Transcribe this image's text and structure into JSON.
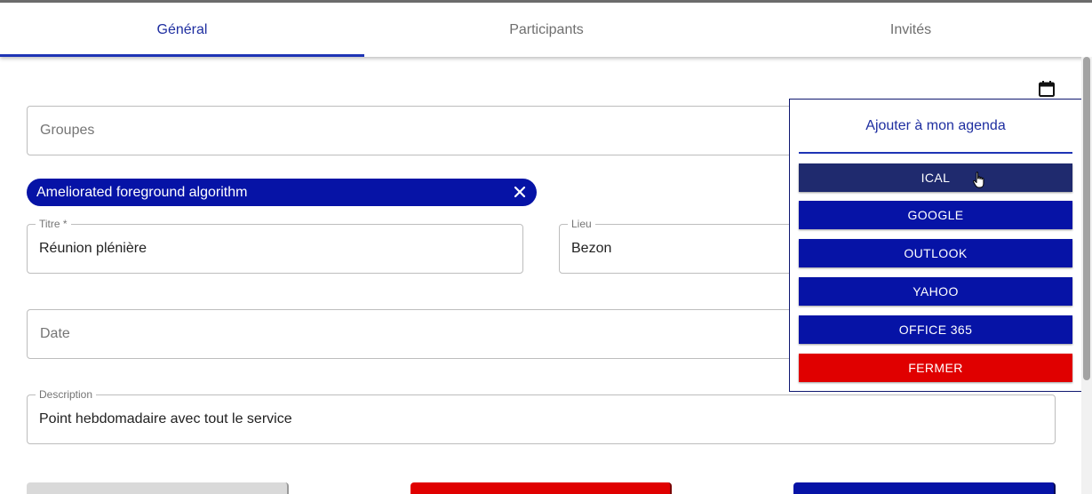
{
  "tabs": [
    {
      "label": "Général",
      "active": true
    },
    {
      "label": "Participants",
      "active": false
    },
    {
      "label": "Invités",
      "active": false
    }
  ],
  "form": {
    "groupes_placeholder": "Groupes",
    "chip_label": "Ameliorated foreground algorithm",
    "titre_label": "Titre *",
    "titre_value": "Réunion plénière",
    "lieu_label": "Lieu",
    "lieu_value": "Bezon",
    "date_placeholder": "Date",
    "description_label": "Description",
    "description_value": "Point hebdomadaire avec tout le service"
  },
  "agenda_popup": {
    "title": "Ajouter à mon agenda",
    "buttons": [
      "ICAL",
      "GOOGLE",
      "OUTLOOK",
      "YAHOO",
      "OFFICE 365"
    ],
    "close_label": "FERMER"
  },
  "icons": {
    "calendar": "calendar-icon",
    "chip_remove": "close-icon",
    "cursor": "hand-pointer-icon"
  },
  "colors": {
    "primary": "#0613a6",
    "primary_hover": "#1f2a6e",
    "danger": "#e00000",
    "tab_active_text": "#1e2ea0",
    "cancel_button": "#d9d9d9"
  }
}
